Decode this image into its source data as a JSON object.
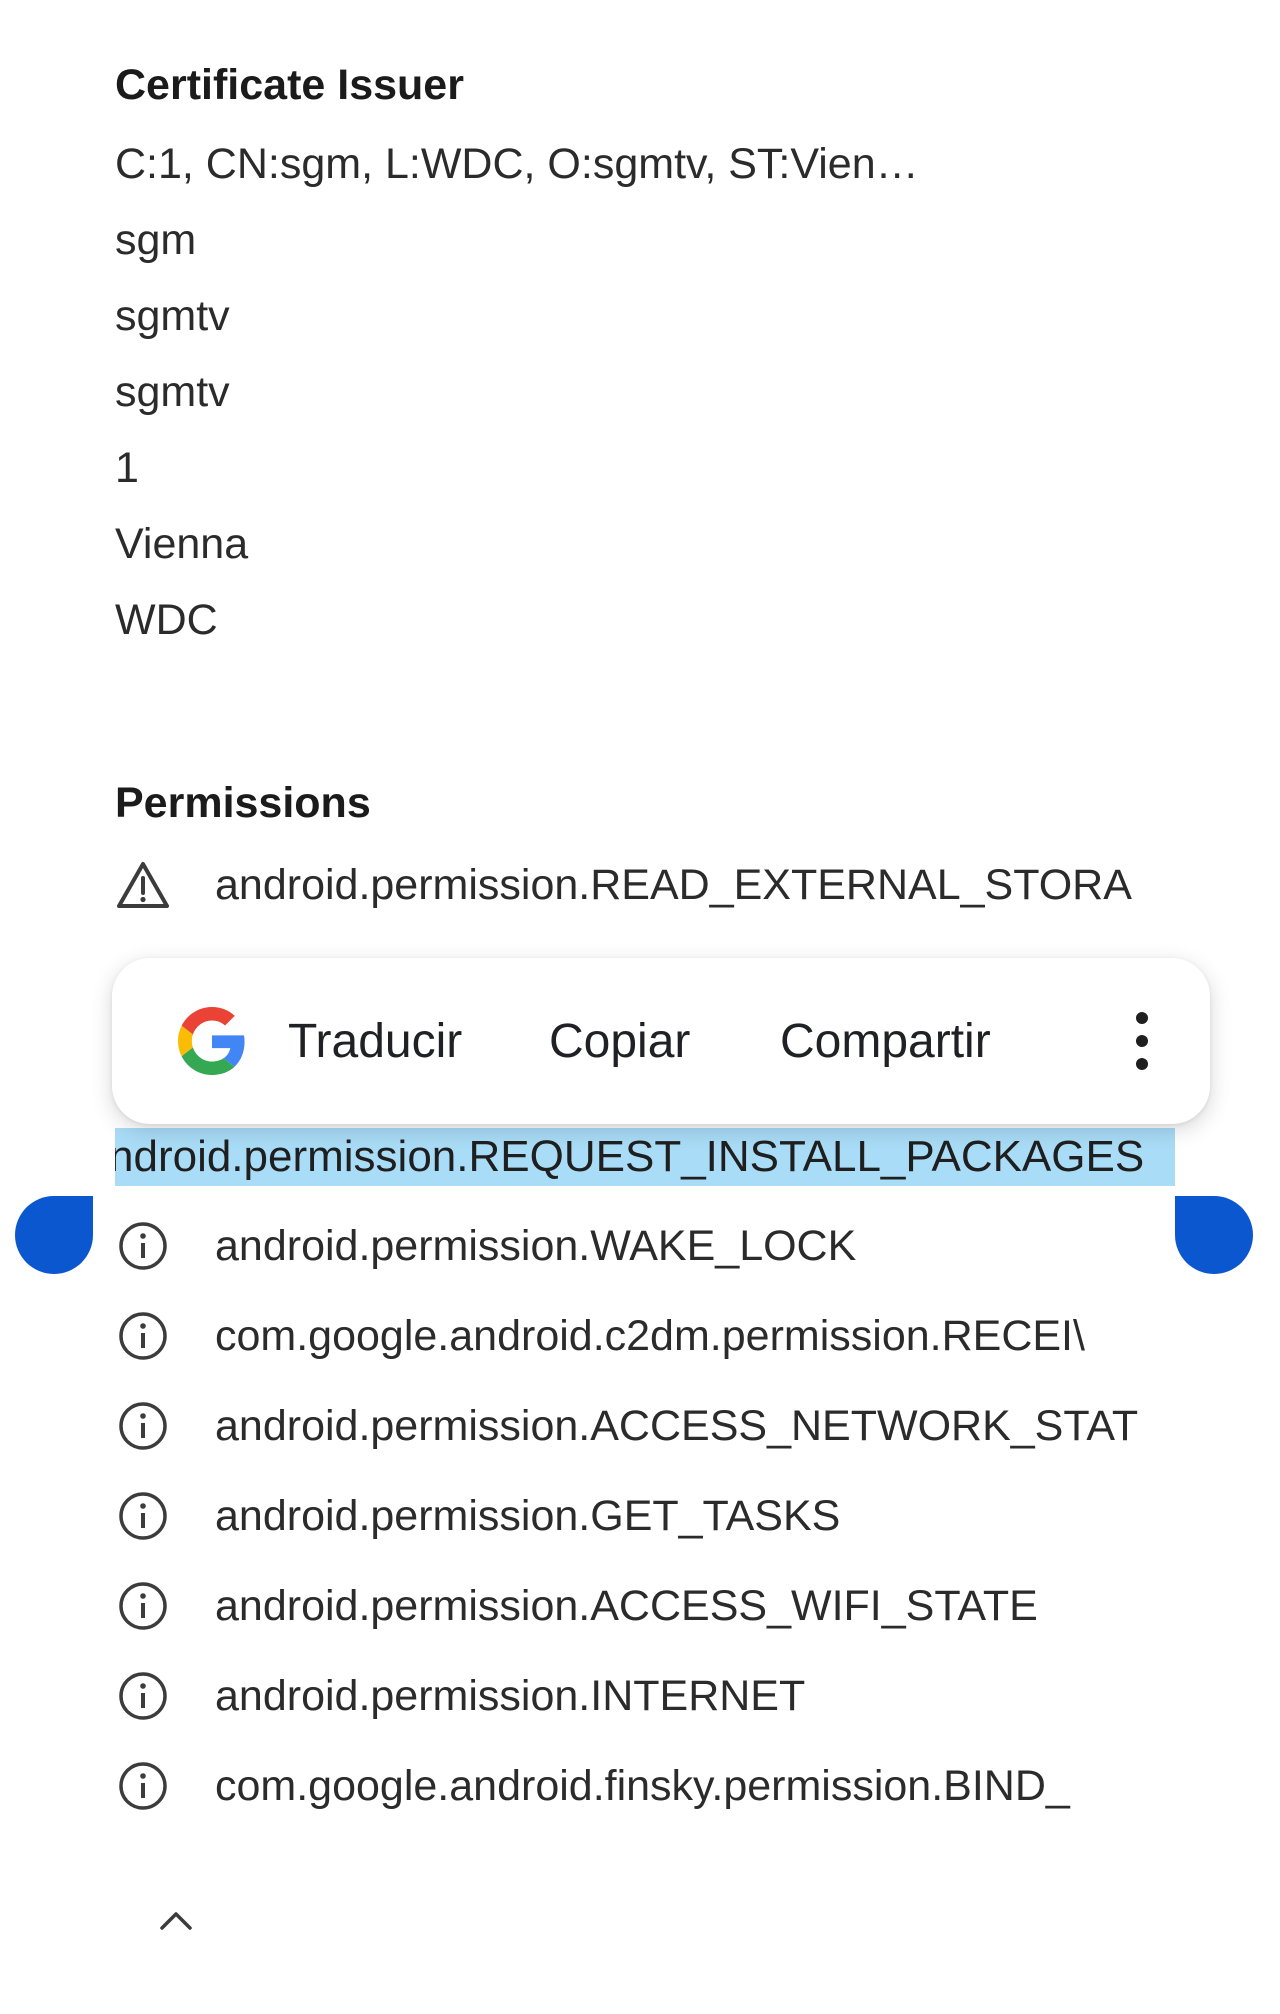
{
  "certificate_issuer": {
    "title": "Certificate Issuer",
    "values": [
      "C:1, CN:sgm, L:WDC, O:sgmtv, ST:Vien…",
      "sgm",
      "sgmtv",
      "sgmtv",
      "1",
      "Vienna",
      "WDC"
    ]
  },
  "permissions": {
    "title": "Permissions",
    "warning_item": {
      "icon": "warning-triangle-icon",
      "text": "android.permission.READ_EXTERNAL_STORA"
    },
    "selected_item": {
      "text": "ndroid.permission.REQUEST_INSTALL_PACKAGES",
      "highlight_color": "#a9dcf7"
    },
    "items": [
      {
        "icon": "info-icon",
        "text": "android.permission.WAKE_LOCK"
      },
      {
        "icon": "info-icon",
        "text": "com.google.android.c2dm.permission.RECEI\\"
      },
      {
        "icon": "info-icon",
        "text": "android.permission.ACCESS_NETWORK_STAT"
      },
      {
        "icon": "info-icon",
        "text": "android.permission.GET_TASKS"
      },
      {
        "icon": "info-icon",
        "text": "android.permission.ACCESS_WIFI_STATE"
      },
      {
        "icon": "info-icon",
        "text": "android.permission.INTERNET"
      },
      {
        "icon": "info-icon",
        "text": "com.google.android.finsky.permission.BIND_"
      }
    ]
  },
  "selection_toolbar": {
    "logo_icon": "google-g-icon",
    "translate_label": "Traducir",
    "copy_label": "Copiar",
    "share_label": "Compartir",
    "more_icon": "more-vert-icon",
    "handle_color": "#0b57d0"
  },
  "footer": {
    "collapse_icon": "chevron-up-icon"
  }
}
